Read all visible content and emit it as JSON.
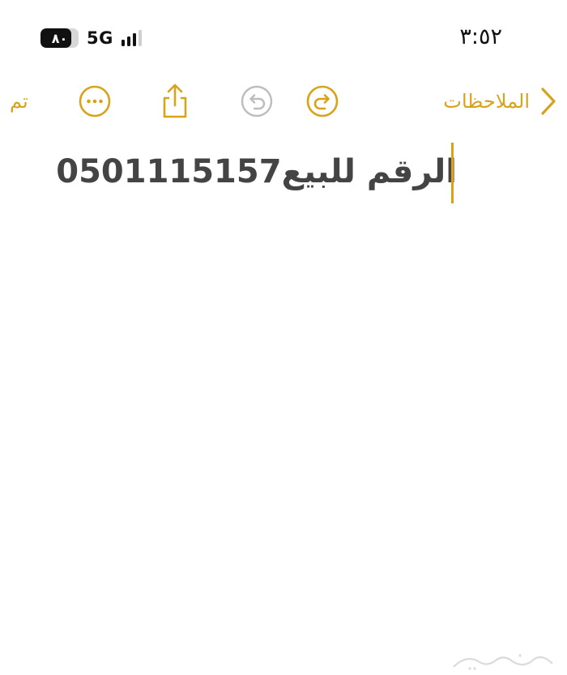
{
  "status_bar": {
    "battery_level": "٨٠",
    "battery_fraction": 0.8,
    "network": "5G",
    "signal_bars_active": 3,
    "signal_bars_total": 4,
    "time": "٣:٥٢"
  },
  "toolbar": {
    "done_label": "تم",
    "back_label": "الملاحظات",
    "more_icon": "ellipsis-circle-icon",
    "share_icon": "share-icon",
    "undo_icon": "undo-icon",
    "redo_icon": "redo-icon"
  },
  "note": {
    "text": "الرقم للبيع0501115157"
  },
  "colors": {
    "accent": "#d8a31b",
    "disabled": "#bdbdbd",
    "text": "#444444"
  }
}
